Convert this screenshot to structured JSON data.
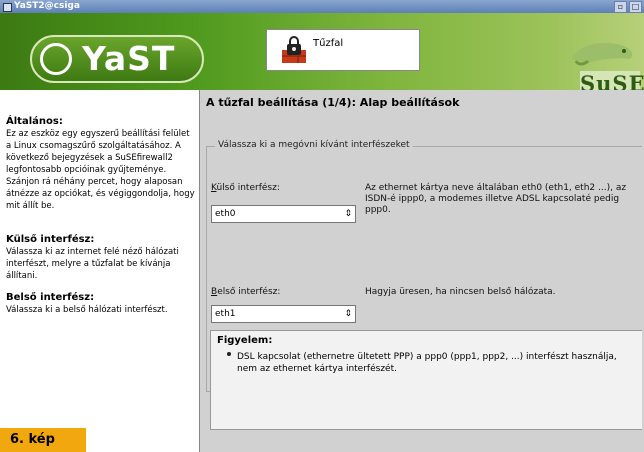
{
  "window": {
    "title": "YaST2@csiga"
  },
  "header": {
    "logo_text": "YaST",
    "module_title": "Tűzfal",
    "brand": "SuSE"
  },
  "help": {
    "section1_title": "Általános:",
    "section1_text": "Ez az eszköz egy egyszerű beállítási felület a Linux csomagszűrő szolgáltatásához. A következő bejegyzések a SuSEfirewall2 legfontosabb opcióinak gyűjteménye. Szánjon rá néhány percet, hogy alaposan átnézze az opciókat, és végiggondolja, hogy mit állít be.",
    "section2_title": "Külső interfész:",
    "section2_text": "Válassza ki az internet felé néző hálózati interfészt, melyre a tűzfalat be kívánja állítani.",
    "section3_title": "Belső interfész:",
    "section3_text": "Válassza ki a belső hálózati interfészt."
  },
  "main": {
    "page_title": "A tűzfal beállítása (1/4): Alap beállítások",
    "group_label": "Válassza ki a megóvni kívánt interfészeket",
    "external": {
      "label_prefix": "K",
      "label_rest": "ülső interfész:",
      "value": "eth0",
      "description": "Az ethernet kártya neve általában eth0 (eth1, eth2 ...), az ISDN-é ippp0, a modemes illetve ADSL kapcsolaté pedig ppp0."
    },
    "internal": {
      "label_prefix": "B",
      "label_rest": "első interfész:",
      "value": "eth1",
      "description": "Hagyja üresen, ha nincsen belső hálózata."
    },
    "note": {
      "title": "Figyelem:",
      "text": "DSL kapcsolat (ethernetre ültetett PPP) a ppp0 (ppp1, ppp2, ...) interfészt használja, nem az ethernet kártya interfészét."
    }
  },
  "caption": "6. kép"
}
